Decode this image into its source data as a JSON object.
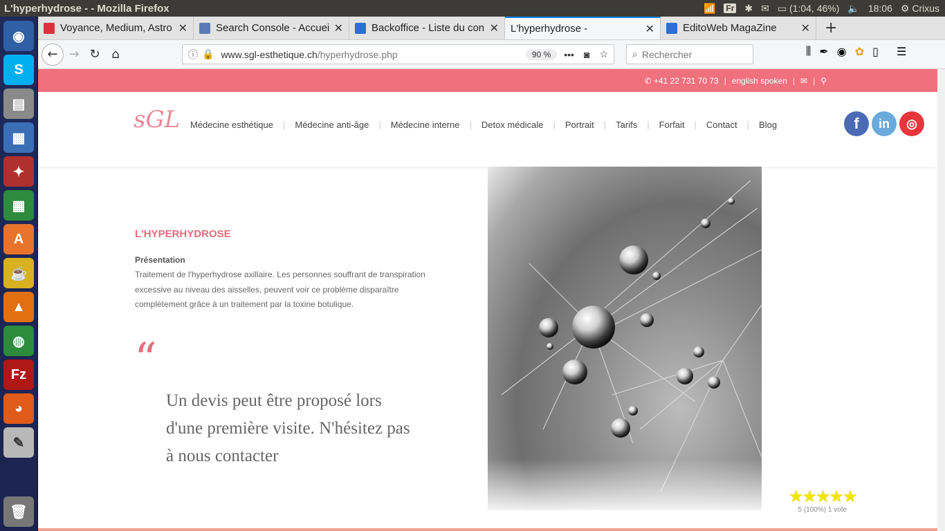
{
  "os": {
    "window_title": "L'hyperhydrose - - Mozilla Firefox",
    "keyboard": "Fr",
    "battery": "(1:04, 46%)",
    "clock": "18:06",
    "user": "Crixus"
  },
  "tabs": [
    {
      "label": "Voyance, Medium, Astro",
      "color": "#d9323c"
    },
    {
      "label": "Search Console - Accueil",
      "color": "#5a7bb5"
    },
    {
      "label": "Backoffice - Liste du con",
      "color": "#2a6fd6"
    },
    {
      "label": "L'hyperhydrose -",
      "color": ""
    },
    {
      "label": "EditoWeb MagaZine",
      "color": "#2a6fd6"
    }
  ],
  "nav": {
    "url_domain": "www.sgl-esthetique.ch",
    "url_path": "/hyperhydrose.php",
    "zoom": "90 %",
    "search_placeholder": "Rechercher"
  },
  "site": {
    "phone": "+41 22 731 70 73",
    "english": "english spoken",
    "logo": "sGL",
    "menu": [
      "Médecine esthétique",
      "Médecine anti-âge",
      "Médecine interne",
      "Detox médicale",
      "Portrait",
      "Tarifs",
      "Forfait",
      "Contact",
      "Blog"
    ],
    "heading": "L'HYPERHYDROSE",
    "presentation_title": "Présentation",
    "presentation_text": "Traitement de l'hyperhydrose axillaire. Les personnes souffrant de transpiration excessive au niveau des aisselles, peuvent voir ce problème disparaître complètement grâce à un traitement par la toxine botulique.",
    "quote_mark": "“",
    "quote": "Un devis peut être proposé lors d'une première visite. N'hésitez pas à nous contacter",
    "rating_stars": "★★★★★",
    "rating_text": "5 (100%) 1 vote",
    "rating_value": 5
  }
}
